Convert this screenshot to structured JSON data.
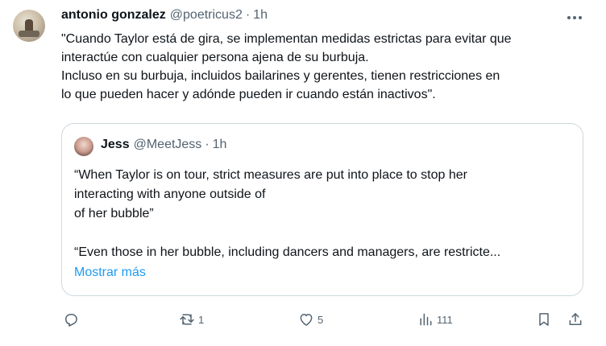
{
  "tweet": {
    "author_name": "antonio gonzalez",
    "author_handle": "@poetricus2",
    "separator": "·",
    "time": "1h",
    "lines": [
      "\"Cuando Taylor está de gira, se implementan medidas estrictas para evitar que",
      "interactúe con cualquier persona ajena de su burbuja.",
      "Incluso en su burbuja, incluidos bailarines y gerentes, tienen restricciones en",
      "lo que pueden hacer y adónde pueden ir cuando están inactivos\"."
    ]
  },
  "quote": {
    "author_name": "Jess",
    "author_handle": "@MeetJess",
    "separator": "·",
    "time": "1h",
    "lines": [
      "“When Taylor is on tour, strict measures are put into place to stop her",
      "interacting with anyone outside of",
      "of her bubble”",
      "",
      "“Even those in her bubble, including dancers and managers, are restricte..."
    ],
    "show_more_label": "Mostrar más"
  },
  "actions": {
    "reply_icon": "reply-icon",
    "retweet_icon": "retweet-icon",
    "retweet_count": "1",
    "like_icon": "heart-icon",
    "like_count": "5",
    "views_icon": "views-icon",
    "views_count": "111",
    "bookmark_icon": "bookmark-icon",
    "share_icon": "share-icon"
  },
  "colors": {
    "text": "#0f1419",
    "secondary": "#536471",
    "link": "#1d9bf0",
    "border": "#cfd9de"
  }
}
